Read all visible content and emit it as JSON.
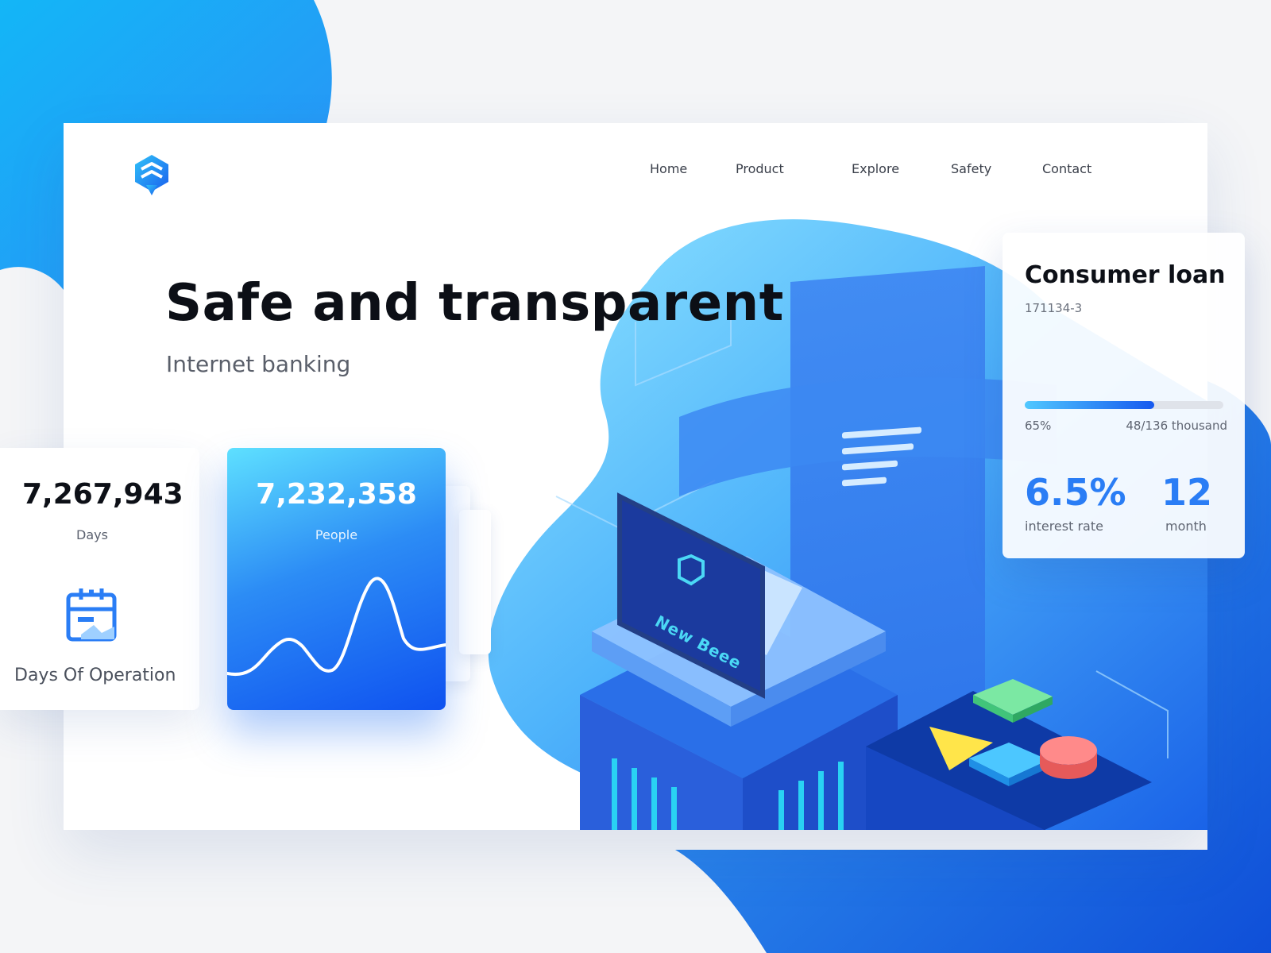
{
  "nav": {
    "items": [
      {
        "label": "Home"
      },
      {
        "label": "Product"
      },
      {
        "label": "Explore"
      },
      {
        "label": "Safety"
      },
      {
        "label": "Contact"
      }
    ]
  },
  "hero": {
    "title": "Safe and transparent",
    "subtitle": "Internet banking"
  },
  "stats": {
    "days": {
      "value": "7,267,943",
      "label": "Days",
      "caption": "Days Of Operation"
    },
    "people": {
      "value": "7,232,358",
      "label": "People"
    }
  },
  "loan": {
    "title": "Consumer loan",
    "id": "171134-3",
    "progress_percent": 65,
    "progress_label": "65%",
    "amount_label": "48/136 thousand",
    "rate_value": "6.5%",
    "rate_label": "interest rate",
    "term_value": "12",
    "term_label": "month"
  },
  "illustration": {
    "laptop_brand": "New Beee"
  },
  "colors": {
    "brand_blue": "#2a7df5",
    "deep_blue": "#0f52f0",
    "cyan": "#51c8ff"
  },
  "icons": [
    "shield-logo-icon",
    "calendar-icon"
  ]
}
